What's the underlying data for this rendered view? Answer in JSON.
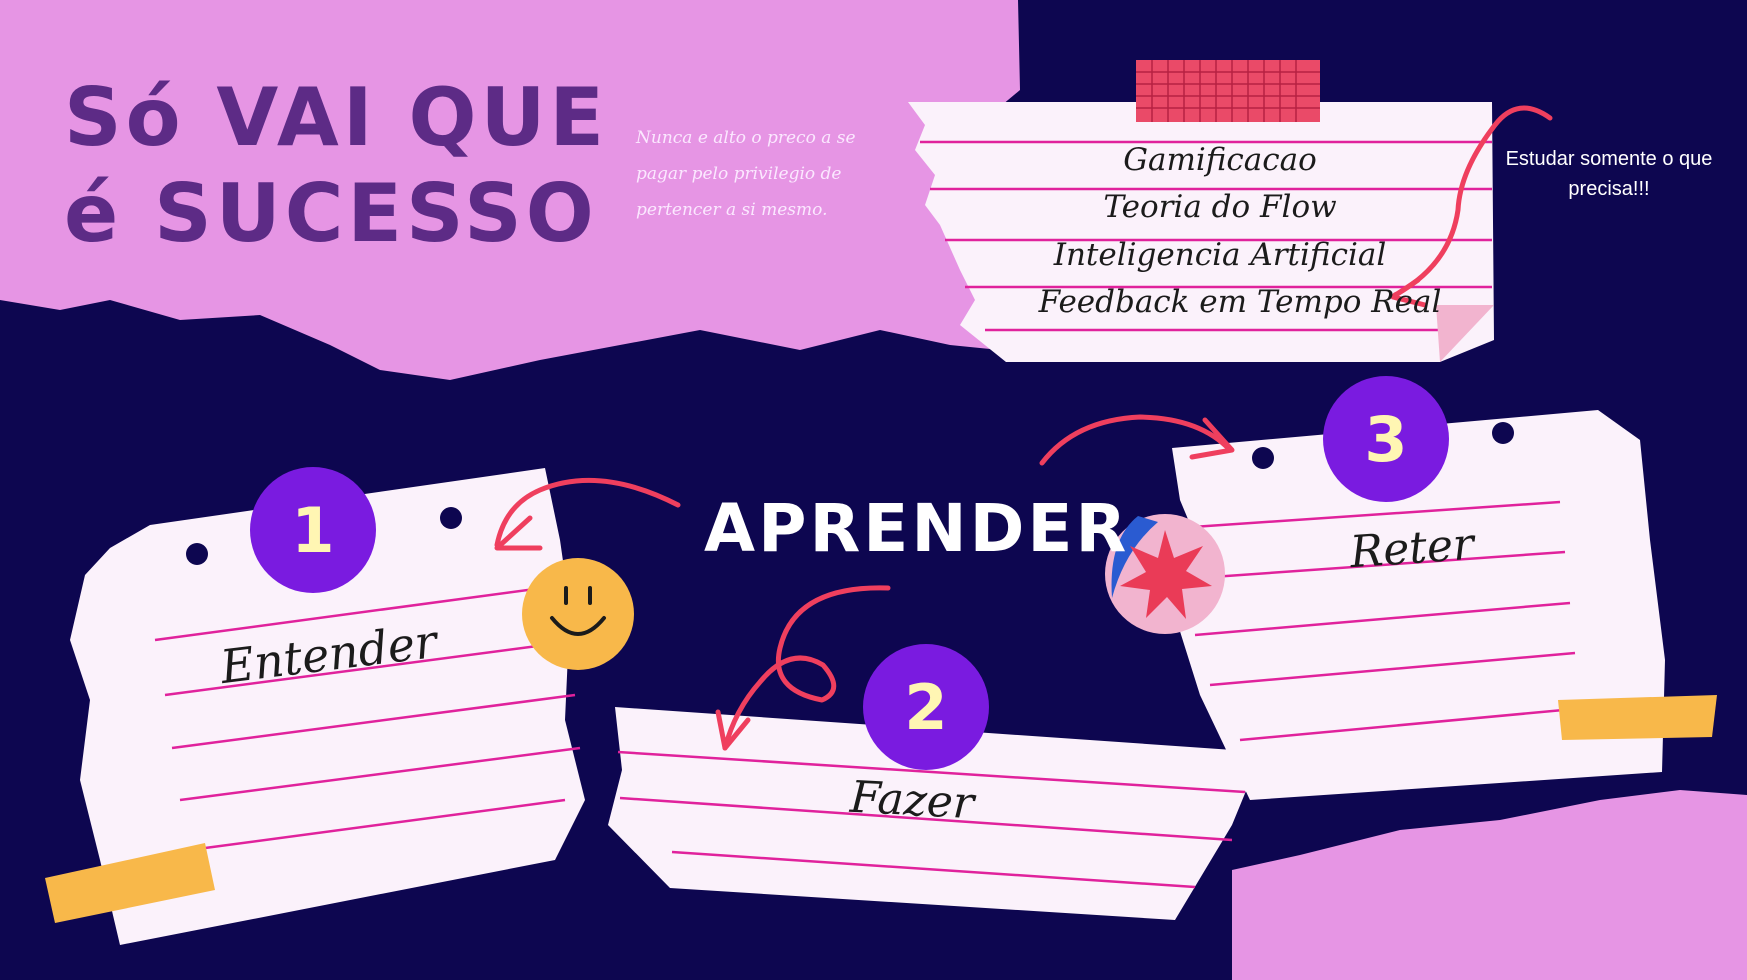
{
  "title_lines": [
    "Só VAI QUE",
    "é SUCESSO"
  ],
  "quote": "Nunca e alto o preco a se pagar pelo privilegio de pertencer a si mesmo.",
  "side_note": "Estudar somente o que precisa!!!",
  "topics": [
    "Gamificacao",
    "Teoria do Flow",
    "Inteligencia Artificial",
    "Feedback em Tempo Real"
  ],
  "center_word": "APRENDER",
  "steps": [
    {
      "number": "1",
      "label": "Entender"
    },
    {
      "number": "2",
      "label": "Fazer"
    },
    {
      "number": "3",
      "label": "Reter"
    }
  ],
  "colors": {
    "background": "#0d0650",
    "pink_paper": "#e695e4",
    "title": "#5d2b86",
    "number_circle": "#7a1be0",
    "number_text": "#fff6b3",
    "arrows": "#ef3f5e",
    "tape_yellow": "#f8b84a",
    "note_paper": "#fbf2fb",
    "note_lines": "#e0229c"
  },
  "icons": [
    "smiley-face-icon",
    "star-sticker-icon",
    "washi-tape-icon"
  ]
}
